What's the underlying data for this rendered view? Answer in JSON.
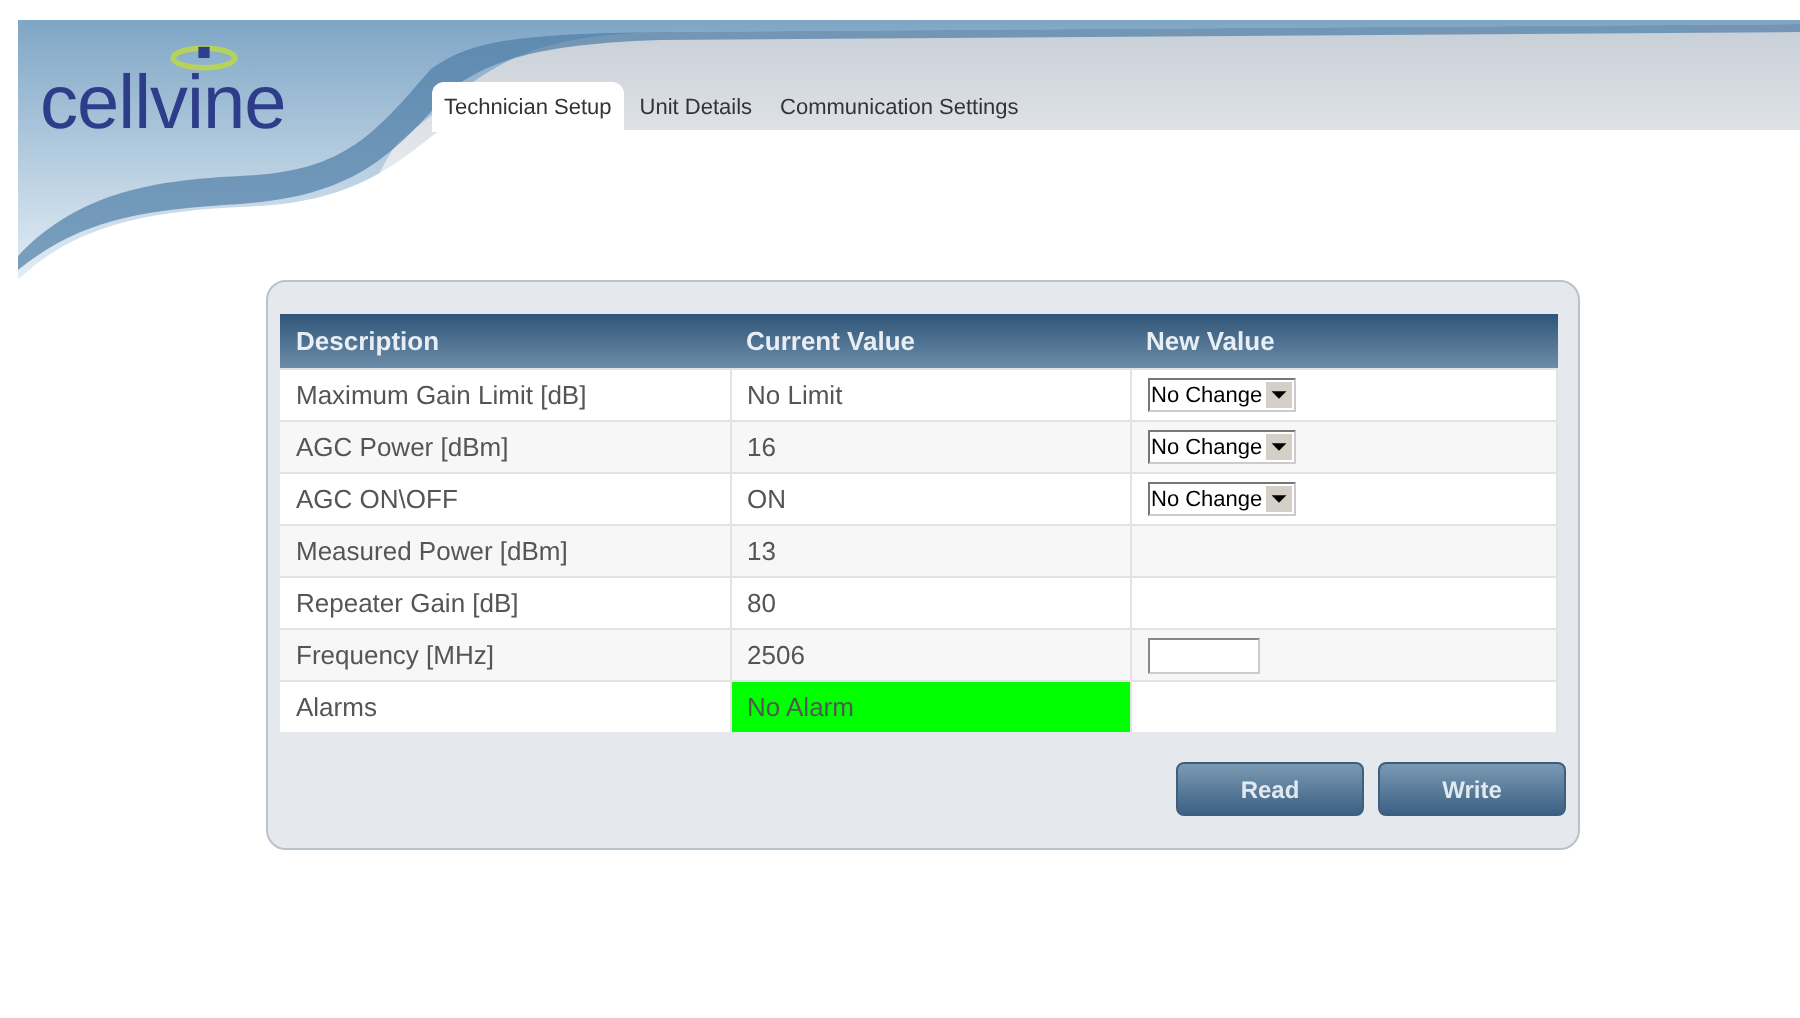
{
  "logo": {
    "text": "cellvine"
  },
  "tabs": [
    {
      "label": "Technician Setup",
      "selected": true
    },
    {
      "label": "Unit Details",
      "selected": false
    },
    {
      "label": "Communication Settings",
      "selected": false
    }
  ],
  "table": {
    "columns": [
      "Description",
      "Current Value",
      "New Value"
    ],
    "rows": [
      {
        "description": "Maximum Gain Limit [dB]",
        "current": "No Limit",
        "new_value": {
          "kind": "select",
          "value": "No Change"
        }
      },
      {
        "description": "AGC Power [dBm]",
        "current": "16",
        "new_value": {
          "kind": "select",
          "value": "No Change"
        }
      },
      {
        "description": "AGC ON\\OFF",
        "current": "ON",
        "new_value": {
          "kind": "select",
          "value": "No Change"
        }
      },
      {
        "description": "Measured Power [dBm]",
        "current": "13",
        "new_value": {
          "kind": "none"
        }
      },
      {
        "description": "Repeater Gain [dB]",
        "current": "80",
        "new_value": {
          "kind": "none"
        }
      },
      {
        "description": "Frequency [MHz]",
        "current": "2506",
        "new_value": {
          "kind": "input"
        }
      },
      {
        "description": "Alarms",
        "current": "No Alarm",
        "color": "#00ff00",
        "new_value": {
          "kind": "none"
        }
      }
    ]
  },
  "buttons": [
    "Read",
    "Write"
  ]
}
